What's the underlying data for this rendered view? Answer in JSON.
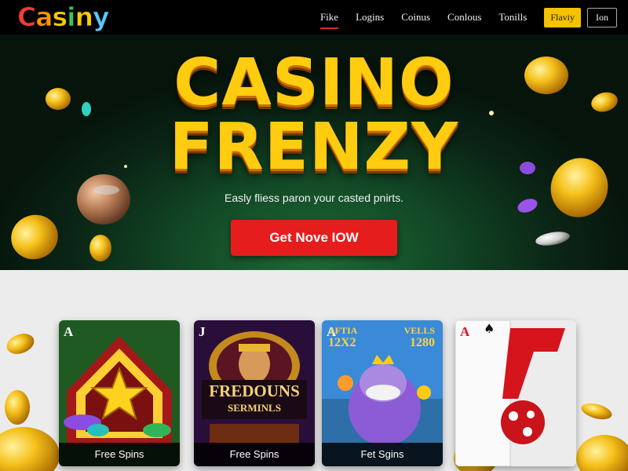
{
  "header": {
    "logo_text": "Casiny",
    "nav": [
      "Fike",
      "Logins",
      "Coinus",
      "Conlous",
      "Tonills"
    ],
    "play_label": "Flaviy",
    "join_label": "Ion"
  },
  "hero": {
    "title_line1": "CASINO",
    "title_line2": "FRENZY",
    "subtitle": "Easly fliess paron your casted pnirts.",
    "cta_label": "Get Nove IOW"
  },
  "cards": [
    {
      "corner": "A",
      "caption": "Free Spins"
    },
    {
      "corner": "J",
      "title": "FREDOUNS",
      "subtitle": "SERMINLS",
      "caption": "Free Spins"
    },
    {
      "corner": "A",
      "banner_left": "AFTIA",
      "banner_left2": "12X2",
      "banner_right": "VELLS",
      "banner_right2": "1280",
      "caption": "Fet Sgins"
    },
    {
      "corner": "A",
      "caption": ""
    }
  ],
  "colors": {
    "cta": "#e51d1d",
    "title_gold": "#ffcc10",
    "play_button": "#f5c200",
    "nav_active_underline": "#e2231a"
  }
}
